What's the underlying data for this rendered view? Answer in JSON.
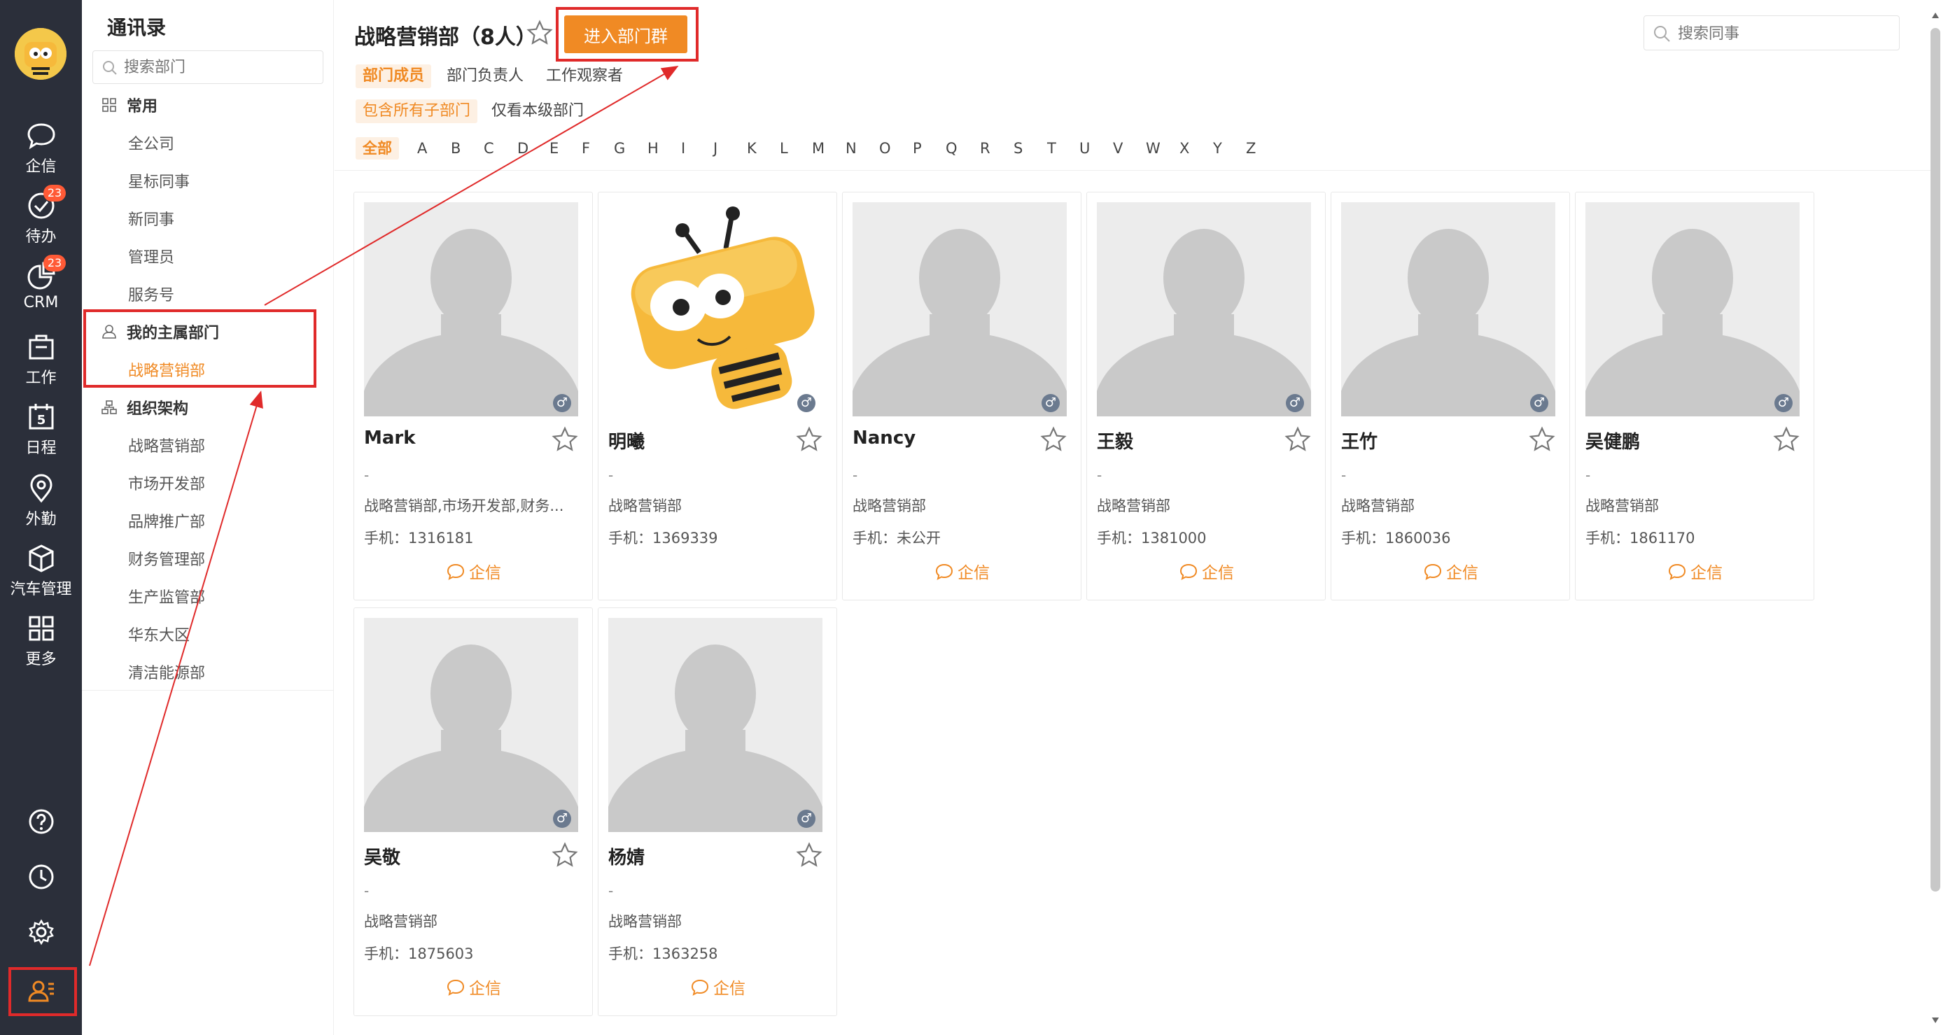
{
  "nav": {
    "items": [
      {
        "label": "企信",
        "icon": "chat-bubble-icon",
        "badge": ""
      },
      {
        "label": "待办",
        "icon": "todo-check-icon",
        "badge": "23"
      },
      {
        "label": "CRM",
        "icon": "crm-chart-icon",
        "badge": "23"
      },
      {
        "label": "工作",
        "icon": "briefcase-icon",
        "badge": ""
      },
      {
        "label": "日程",
        "icon": "calendar-icon",
        "badge": ""
      },
      {
        "label": "外勤",
        "icon": "location-pin-icon",
        "badge": ""
      },
      {
        "label": "汽车管理",
        "icon": "cube-icon",
        "badge": ""
      },
      {
        "label": "更多",
        "icon": "grid-icon",
        "badge": ""
      }
    ],
    "calendar_day": "5",
    "bottom_icons": [
      "help-icon",
      "clock-icon",
      "settings-icon",
      "contacts-icon"
    ]
  },
  "directory": {
    "title": "通讯录",
    "search_placeholder": "搜索部门",
    "common_label": "常用",
    "common_items": [
      "全公司",
      "星标同事",
      "新同事",
      "管理员",
      "服务号"
    ],
    "my_dept_label": "我的主属部门",
    "my_dept_item": "战略营销部",
    "org_label": "组织架构",
    "org_items": [
      "战略营销部",
      "市场开发部",
      "品牌推广部",
      "财务管理部",
      "生产监管部",
      "华东大区",
      "清洁能源部"
    ]
  },
  "main": {
    "dept_title": "战略营销部（8人）",
    "join_button": "进入部门群",
    "search_placeholder": "搜索同事",
    "tabs_row1": [
      "部门成员",
      "部门负责人",
      "工作观察者"
    ],
    "tabs_row2": [
      "包含所有子部门",
      "仅看本级部门"
    ],
    "letters": [
      "全部",
      "A",
      "B",
      "C",
      "D",
      "E",
      "F",
      "G",
      "H",
      "I",
      "J",
      "K",
      "L",
      "M",
      "N",
      "O",
      "P",
      "Q",
      "R",
      "S",
      "T",
      "U",
      "V",
      "W",
      "X",
      "Y",
      "Z"
    ],
    "accent_color": "#f08a24",
    "highlight_color": "#e02a2a"
  },
  "members": [
    {
      "name": "Mark",
      "dash": "-",
      "dept": "战略营销部,市场开发部,财务...",
      "phone": "手机：1316181",
      "chat": "企信",
      "avatar": "default"
    },
    {
      "name": "明曦",
      "dash": "-",
      "dept": "战略营销部",
      "phone": "手机：1369339",
      "chat": "",
      "avatar": "bee"
    },
    {
      "name": "Nancy",
      "dash": "-",
      "dept": "战略营销部",
      "phone": "手机：未公开",
      "chat": "企信",
      "avatar": "default"
    },
    {
      "name": "王毅",
      "dash": "-",
      "dept": "战略营销部",
      "phone": "手机：1381000",
      "chat": "企信",
      "avatar": "default"
    },
    {
      "name": "王竹",
      "dash": "-",
      "dept": "战略营销部",
      "phone": "手机：1860036",
      "chat": "企信",
      "avatar": "default"
    },
    {
      "name": "吴健鹏",
      "dash": "-",
      "dept": "战略营销部",
      "phone": "手机：1861170",
      "chat": "企信",
      "avatar": "default"
    },
    {
      "name": "吴敬",
      "dash": "-",
      "dept": "战略营销部",
      "phone": "手机：1875603",
      "chat": "企信",
      "avatar": "default"
    },
    {
      "name": "杨婧",
      "dash": "-",
      "dept": "战略营销部",
      "phone": "手机：1363258",
      "chat": "企信",
      "avatar": "default"
    }
  ],
  "gender_symbol": "♂"
}
